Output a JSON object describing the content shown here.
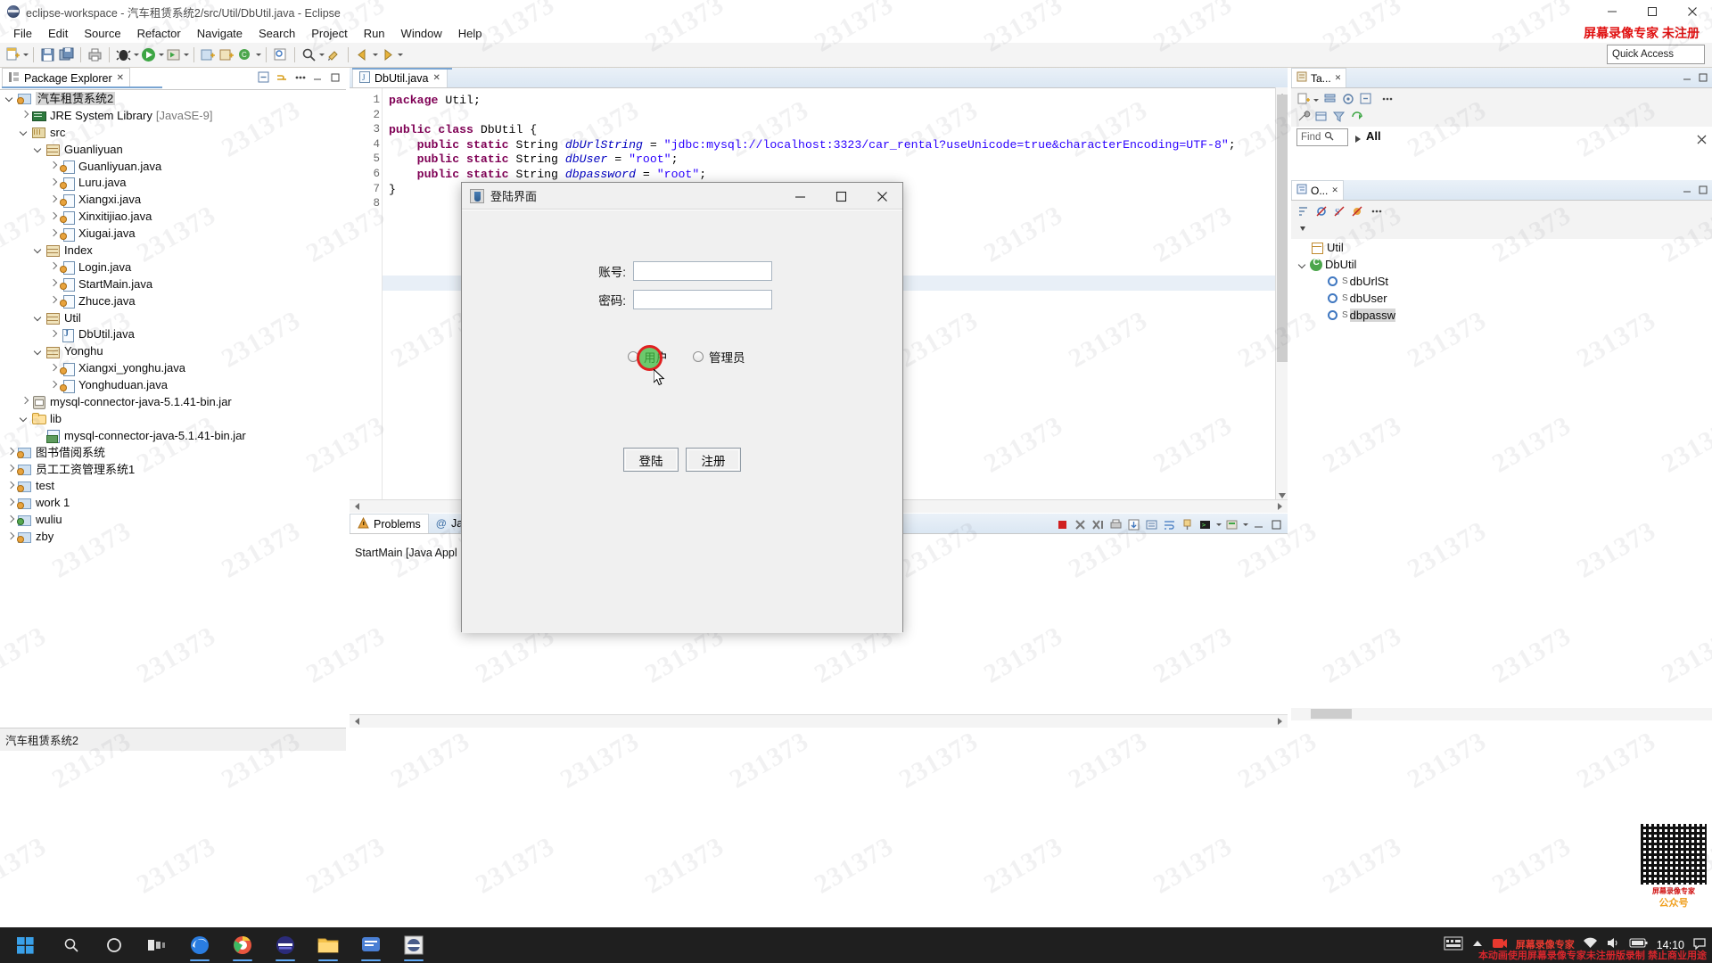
{
  "window": {
    "title": "eclipse-workspace - 汽车租赁系统2/src/Util/DbUtil.java - Eclipse",
    "registration_notice": "屏幕录像专家 未注册",
    "minimize": "–",
    "maximize": "□",
    "close": "✕"
  },
  "menubar": {
    "items": [
      "File",
      "Edit",
      "Source",
      "Refactor",
      "Navigate",
      "Search",
      "Project",
      "Run",
      "Window",
      "Help"
    ]
  },
  "toolbar": {
    "quick_access_placeholder": "Quick Access"
  },
  "package_explorer": {
    "tab_label": "Package Explorer",
    "close_glyph": "✕",
    "status_text": "汽车租赁系统2",
    "tree": [
      {
        "depth": 0,
        "twisty": "open",
        "icon": "proj-warn",
        "label": "汽车租赁系统2",
        "selected": true,
        "dim": ""
      },
      {
        "depth": 1,
        "twisty": "closed",
        "icon": "jre",
        "label": "JRE System Library",
        "dim": "[JavaSE-9]"
      },
      {
        "depth": 1,
        "twisty": "open",
        "icon": "src",
        "label": "src",
        "dim": ""
      },
      {
        "depth": 2,
        "twisty": "open",
        "icon": "pkg-warn",
        "label": "Guanliyuan",
        "dim": ""
      },
      {
        "depth": 3,
        "twisty": "closed",
        "icon": "java-warn",
        "label": "Guanliyuan.java",
        "dim": ""
      },
      {
        "depth": 3,
        "twisty": "closed",
        "icon": "java-warn",
        "label": "Luru.java",
        "dim": ""
      },
      {
        "depth": 3,
        "twisty": "closed",
        "icon": "java-warn",
        "label": "Xiangxi.java",
        "dim": ""
      },
      {
        "depth": 3,
        "twisty": "closed",
        "icon": "java-warn",
        "label": "Xinxitijiao.java",
        "dim": ""
      },
      {
        "depth": 3,
        "twisty": "closed",
        "icon": "java-warn",
        "label": "Xiugai.java",
        "dim": ""
      },
      {
        "depth": 2,
        "twisty": "open",
        "icon": "pkg-warn",
        "label": "Index",
        "dim": ""
      },
      {
        "depth": 3,
        "twisty": "closed",
        "icon": "java-warn",
        "label": "Login.java",
        "dim": ""
      },
      {
        "depth": 3,
        "twisty": "closed",
        "icon": "java-warn",
        "label": "StartMain.java",
        "dim": ""
      },
      {
        "depth": 3,
        "twisty": "closed",
        "icon": "java-warn",
        "label": "Zhuce.java",
        "dim": ""
      },
      {
        "depth": 2,
        "twisty": "open",
        "icon": "pkg",
        "label": "Util",
        "dim": ""
      },
      {
        "depth": 3,
        "twisty": "closed",
        "icon": "java",
        "label": "DbUtil.java",
        "dim": ""
      },
      {
        "depth": 2,
        "twisty": "open",
        "icon": "pkg-warn",
        "label": "Yonghu",
        "dim": ""
      },
      {
        "depth": 3,
        "twisty": "closed",
        "icon": "java-warn",
        "label": "Xiangxi_yonghu.java",
        "dim": ""
      },
      {
        "depth": 3,
        "twisty": "closed",
        "icon": "java-warn",
        "label": "Yonghuduan.java",
        "dim": ""
      },
      {
        "depth": 1,
        "twisty": "closed",
        "icon": "jar",
        "label": "mysql-connector-java-5.1.41-bin.jar",
        "dim": ""
      },
      {
        "depth": 1,
        "twisty": "open",
        "icon": "folder",
        "label": "lib",
        "dim": ""
      },
      {
        "depth": 2,
        "twisty": "none",
        "icon": "jarfile",
        "label": "mysql-connector-java-5.1.41-bin.jar",
        "dim": ""
      },
      {
        "depth": 0,
        "twisty": "closed",
        "icon": "proj-warn",
        "label": "图书借阅系统",
        "dim": ""
      },
      {
        "depth": 0,
        "twisty": "closed",
        "icon": "proj-warn",
        "label": "员工工资管理系统1",
        "dim": ""
      },
      {
        "depth": 0,
        "twisty": "closed",
        "icon": "proj-warn",
        "label": "test",
        "dim": ""
      },
      {
        "depth": 0,
        "twisty": "closed",
        "icon": "proj-warn",
        "label": "work 1",
        "dim": ""
      },
      {
        "depth": 0,
        "twisty": "closed",
        "icon": "proj-green",
        "label": "wuliu",
        "dim": ""
      },
      {
        "depth": 0,
        "twisty": "closed",
        "icon": "proj-warn",
        "label": "zby",
        "dim": ""
      }
    ]
  },
  "editor": {
    "tab_label": "DbUtil.java",
    "tab_close": "✕",
    "line_numbers": [
      "1",
      "2",
      "3",
      "4",
      "5",
      "6",
      "7",
      "8"
    ],
    "lines": [
      [
        {
          "t": "package ",
          "c": "kw"
        },
        {
          "t": "Util;",
          "c": "pln"
        }
      ],
      [],
      [
        {
          "t": "public class ",
          "c": "kw"
        },
        {
          "t": "DbUtil {",
          "c": "pln"
        }
      ],
      [
        {
          "t": "    ",
          "c": "pln"
        },
        {
          "t": "public static ",
          "c": "kw"
        },
        {
          "t": "String ",
          "c": "pln"
        },
        {
          "t": "dbUrlString",
          "c": "fld"
        },
        {
          "t": " = ",
          "c": "pln"
        },
        {
          "t": "\"jdbc:mysql://localhost:3323/car_rental?useUnicode=true&characterEncoding=UTF-8\"",
          "c": "str"
        },
        {
          "t": ";",
          "c": "pln"
        }
      ],
      [
        {
          "t": "    ",
          "c": "pln"
        },
        {
          "t": "public static ",
          "c": "kw"
        },
        {
          "t": "String ",
          "c": "pln"
        },
        {
          "t": "dbUser",
          "c": "fld"
        },
        {
          "t": " = ",
          "c": "pln"
        },
        {
          "t": "\"root\"",
          "c": "str"
        },
        {
          "t": ";",
          "c": "pln"
        }
      ],
      [
        {
          "t": "    ",
          "c": "pln"
        },
        {
          "t": "public static ",
          "c": "kw"
        },
        {
          "t": "String ",
          "c": "pln"
        },
        {
          "t": "dbpassword",
          "c": "fld"
        },
        {
          "t": " = ",
          "c": "pln"
        },
        {
          "t": "\"root\"",
          "c": "str"
        },
        {
          "t": ";",
          "c": "pln"
        }
      ],
      [
        {
          "t": "}",
          "c": "pln"
        }
      ],
      []
    ]
  },
  "console": {
    "problems_tab": "Problems",
    "javadoc_tab": "Java",
    "launch_text": "StartMain [Java Appl"
  },
  "right_panel": {
    "tasks_tab": "Ta...",
    "outline_tab": "O...",
    "find_placeholder": "Find",
    "all_label": "All",
    "outline_tree": [
      {
        "depth": 0,
        "icon": "pkg",
        "label": "Util",
        "twisty": "none",
        "sup": ""
      },
      {
        "depth": 0,
        "icon": "class",
        "label": "DbUtil",
        "twisty": "open",
        "sup": ""
      },
      {
        "depth": 1,
        "icon": "field",
        "label": "dbUrlSt",
        "sup": "S",
        "selected": false
      },
      {
        "depth": 1,
        "icon": "field",
        "label": "dbUser",
        "sup": "S",
        "selected": false
      },
      {
        "depth": 1,
        "icon": "field",
        "label": "dbpassw",
        "sup": "S",
        "selected": true
      }
    ]
  },
  "login_dialog": {
    "title": "登陆界面",
    "minimize": "—",
    "maximize": "□",
    "close": "✕",
    "account_label": "账号:",
    "account_value": "",
    "password_label": "密码:",
    "password_value": "",
    "radio_user": "用户",
    "radio_admin": "管理员",
    "login_button": "登陆",
    "register_button": "注册"
  },
  "taskbar": {
    "clock_time": "14:10",
    "tray_brand_line1": "屏幕录像专家",
    "promo_text": "本动画使用屏幕录像专家未注册版录制  禁止商业用途",
    "qr_brand": "屏幕录像专家",
    "qr_sub": "公众号"
  },
  "watermark": {
    "text": "231373"
  }
}
